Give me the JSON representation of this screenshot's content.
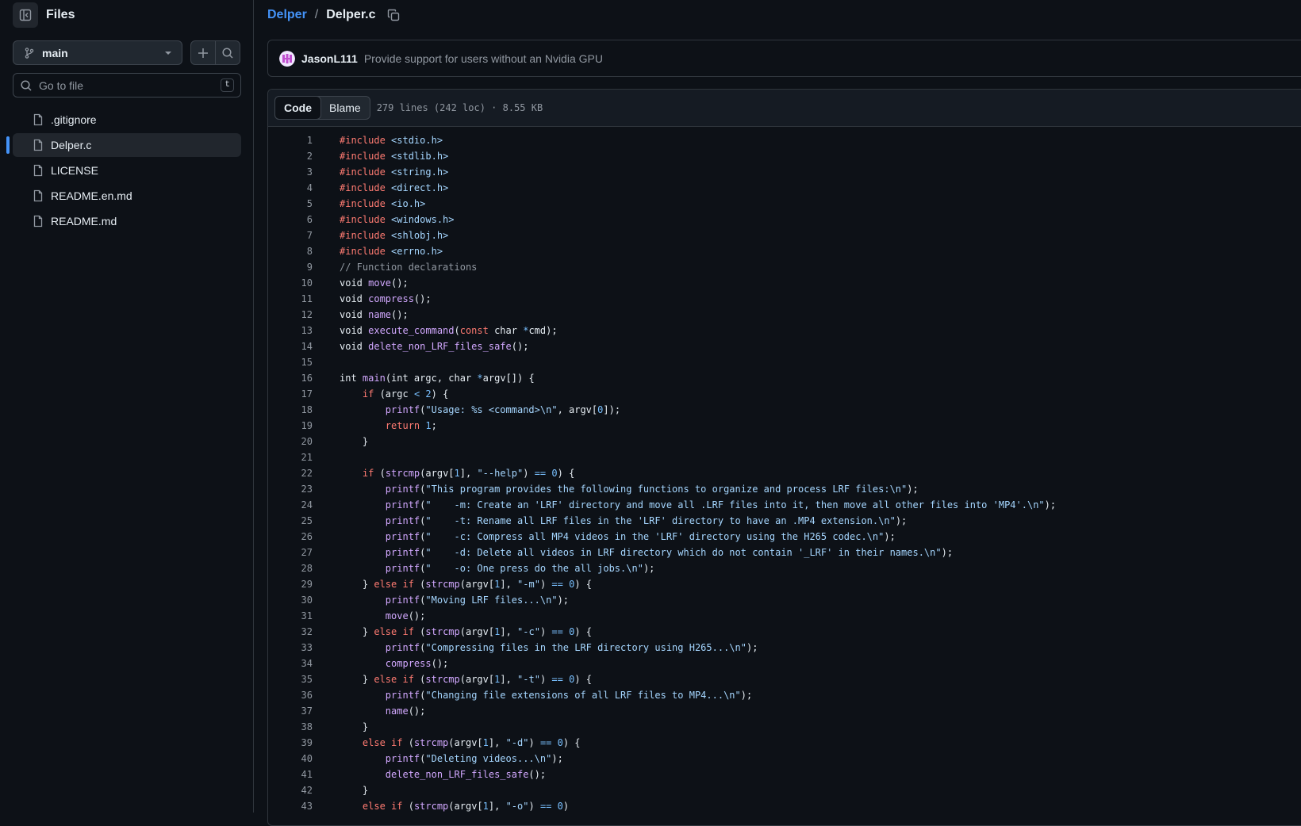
{
  "sidebar": {
    "title": "Files",
    "branch": "main",
    "goto_placeholder": "Go to file",
    "goto_shortcut": "t",
    "files": [
      ".gitignore",
      "Delper.c",
      "LICENSE",
      "README.en.md",
      "README.md"
    ]
  },
  "breadcrumb": {
    "repo": "Delper",
    "separator": "/",
    "file": "Delper.c"
  },
  "commit": {
    "author": "JasonL111",
    "message": "Provide support for users without an Nvidia GPU"
  },
  "viewer": {
    "tabs": [
      "Code",
      "Blame"
    ],
    "info": "279 lines (242 loc) · 8.55 KB",
    "lines": [
      [
        [
          "kw",
          "#include"
        ],
        [
          "t",
          " "
        ],
        [
          "str",
          "<stdio.h>"
        ]
      ],
      [
        [
          "kw",
          "#include"
        ],
        [
          "t",
          " "
        ],
        [
          "str",
          "<stdlib.h>"
        ]
      ],
      [
        [
          "kw",
          "#include"
        ],
        [
          "t",
          " "
        ],
        [
          "str",
          "<string.h>"
        ]
      ],
      [
        [
          "kw",
          "#include"
        ],
        [
          "t",
          " "
        ],
        [
          "str",
          "<direct.h>"
        ]
      ],
      [
        [
          "kw",
          "#include"
        ],
        [
          "t",
          " "
        ],
        [
          "str",
          "<io.h>"
        ]
      ],
      [
        [
          "kw",
          "#include"
        ],
        [
          "t",
          " "
        ],
        [
          "str",
          "<windows.h>"
        ]
      ],
      [
        [
          "kw",
          "#include"
        ],
        [
          "t",
          " "
        ],
        [
          "str",
          "<shlobj.h>"
        ]
      ],
      [
        [
          "kw",
          "#include"
        ],
        [
          "t",
          " "
        ],
        [
          "str",
          "<errno.h>"
        ]
      ],
      [
        [
          "cm",
          "// Function declarations"
        ]
      ],
      [
        [
          "t",
          "void "
        ],
        [
          "fn",
          "move"
        ],
        [
          "t",
          "();"
        ]
      ],
      [
        [
          "t",
          "void "
        ],
        [
          "fn",
          "compress"
        ],
        [
          "t",
          "();"
        ]
      ],
      [
        [
          "t",
          "void "
        ],
        [
          "fn",
          "name"
        ],
        [
          "t",
          "();"
        ]
      ],
      [
        [
          "t",
          "void "
        ],
        [
          "fn",
          "execute_command"
        ],
        [
          "t",
          "("
        ],
        [
          "kw",
          "const"
        ],
        [
          "t",
          " char "
        ],
        [
          "op",
          "*"
        ],
        [
          "t",
          "cmd);"
        ]
      ],
      [
        [
          "t",
          "void "
        ],
        [
          "fn",
          "delete_non_LRF_files_safe"
        ],
        [
          "t",
          "();"
        ]
      ],
      [],
      [
        [
          "t",
          "int "
        ],
        [
          "fn",
          "main"
        ],
        [
          "t",
          "(int argc, char "
        ],
        [
          "op",
          "*"
        ],
        [
          "t",
          "argv[]) {"
        ]
      ],
      [
        [
          "t",
          "    "
        ],
        [
          "kw",
          "if"
        ],
        [
          "t",
          " (argc "
        ],
        [
          "op",
          "<"
        ],
        [
          "t",
          " "
        ],
        [
          "num",
          "2"
        ],
        [
          "t",
          ") {"
        ]
      ],
      [
        [
          "t",
          "        "
        ],
        [
          "fn",
          "printf"
        ],
        [
          "t",
          "("
        ],
        [
          "str",
          "\"Usage: %s <command>\\n\""
        ],
        [
          "t",
          ", argv["
        ],
        [
          "num",
          "0"
        ],
        [
          "t",
          "]);"
        ]
      ],
      [
        [
          "t",
          "        "
        ],
        [
          "kw",
          "return"
        ],
        [
          "t",
          " "
        ],
        [
          "num",
          "1"
        ],
        [
          "t",
          ";"
        ]
      ],
      [
        [
          "t",
          "    }"
        ]
      ],
      [],
      [
        [
          "t",
          "    "
        ],
        [
          "kw",
          "if"
        ],
        [
          "t",
          " ("
        ],
        [
          "fn",
          "strcmp"
        ],
        [
          "t",
          "(argv["
        ],
        [
          "num",
          "1"
        ],
        [
          "t",
          "], "
        ],
        [
          "str",
          "\"--help\""
        ],
        [
          "t",
          ") "
        ],
        [
          "op",
          "=="
        ],
        [
          "t",
          " "
        ],
        [
          "num",
          "0"
        ],
        [
          "t",
          ") {"
        ]
      ],
      [
        [
          "t",
          "        "
        ],
        [
          "fn",
          "printf"
        ],
        [
          "t",
          "("
        ],
        [
          "str",
          "\"This program provides the following functions to organize and process LRF files:\\n\""
        ],
        [
          "t",
          ");"
        ]
      ],
      [
        [
          "t",
          "        "
        ],
        [
          "fn",
          "printf"
        ],
        [
          "t",
          "("
        ],
        [
          "str",
          "\"    -m: Create an 'LRF' directory and move all .LRF files into it, then move all other files into 'MP4'.\\n\""
        ],
        [
          "t",
          ");"
        ]
      ],
      [
        [
          "t",
          "        "
        ],
        [
          "fn",
          "printf"
        ],
        [
          "t",
          "("
        ],
        [
          "str",
          "\"    -t: Rename all LRF files in the 'LRF' directory to have an .MP4 extension.\\n\""
        ],
        [
          "t",
          ");"
        ]
      ],
      [
        [
          "t",
          "        "
        ],
        [
          "fn",
          "printf"
        ],
        [
          "t",
          "("
        ],
        [
          "str",
          "\"    -c: Compress all MP4 videos in the 'LRF' directory using the H265 codec.\\n\""
        ],
        [
          "t",
          ");"
        ]
      ],
      [
        [
          "t",
          "        "
        ],
        [
          "fn",
          "printf"
        ],
        [
          "t",
          "("
        ],
        [
          "str",
          "\"    -d: Delete all videos in LRF directory which do not contain '_LRF' in their names.\\n\""
        ],
        [
          "t",
          ");"
        ]
      ],
      [
        [
          "t",
          "        "
        ],
        [
          "fn",
          "printf"
        ],
        [
          "t",
          "("
        ],
        [
          "str",
          "\"    -o: One press do the all jobs.\\n\""
        ],
        [
          "t",
          ");"
        ]
      ],
      [
        [
          "t",
          "    } "
        ],
        [
          "kw",
          "else if"
        ],
        [
          "t",
          " ("
        ],
        [
          "fn",
          "strcmp"
        ],
        [
          "t",
          "(argv["
        ],
        [
          "num",
          "1"
        ],
        [
          "t",
          "], "
        ],
        [
          "str",
          "\"-m\""
        ],
        [
          "t",
          ") "
        ],
        [
          "op",
          "=="
        ],
        [
          "t",
          " "
        ],
        [
          "num",
          "0"
        ],
        [
          "t",
          ") {"
        ]
      ],
      [
        [
          "t",
          "        "
        ],
        [
          "fn",
          "printf"
        ],
        [
          "t",
          "("
        ],
        [
          "str",
          "\"Moving LRF files...\\n\""
        ],
        [
          "t",
          ");"
        ]
      ],
      [
        [
          "t",
          "        "
        ],
        [
          "fn",
          "move"
        ],
        [
          "t",
          "();"
        ]
      ],
      [
        [
          "t",
          "    } "
        ],
        [
          "kw",
          "else if"
        ],
        [
          "t",
          " ("
        ],
        [
          "fn",
          "strcmp"
        ],
        [
          "t",
          "(argv["
        ],
        [
          "num",
          "1"
        ],
        [
          "t",
          "], "
        ],
        [
          "str",
          "\"-c\""
        ],
        [
          "t",
          ") "
        ],
        [
          "op",
          "=="
        ],
        [
          "t",
          " "
        ],
        [
          "num",
          "0"
        ],
        [
          "t",
          ") {"
        ]
      ],
      [
        [
          "t",
          "        "
        ],
        [
          "fn",
          "printf"
        ],
        [
          "t",
          "("
        ],
        [
          "str",
          "\"Compressing files in the LRF directory using H265...\\n\""
        ],
        [
          "t",
          ");"
        ]
      ],
      [
        [
          "t",
          "        "
        ],
        [
          "fn",
          "compress"
        ],
        [
          "t",
          "();"
        ]
      ],
      [
        [
          "t",
          "    } "
        ],
        [
          "kw",
          "else if"
        ],
        [
          "t",
          " ("
        ],
        [
          "fn",
          "strcmp"
        ],
        [
          "t",
          "(argv["
        ],
        [
          "num",
          "1"
        ],
        [
          "t",
          "], "
        ],
        [
          "str",
          "\"-t\""
        ],
        [
          "t",
          ") "
        ],
        [
          "op",
          "=="
        ],
        [
          "t",
          " "
        ],
        [
          "num",
          "0"
        ],
        [
          "t",
          ") {"
        ]
      ],
      [
        [
          "t",
          "        "
        ],
        [
          "fn",
          "printf"
        ],
        [
          "t",
          "("
        ],
        [
          "str",
          "\"Changing file extensions of all LRF files to MP4...\\n\""
        ],
        [
          "t",
          ");"
        ]
      ],
      [
        [
          "t",
          "        "
        ],
        [
          "fn",
          "name"
        ],
        [
          "t",
          "();"
        ]
      ],
      [
        [
          "t",
          "    }"
        ]
      ],
      [
        [
          "t",
          "    "
        ],
        [
          "kw",
          "else if"
        ],
        [
          "t",
          " ("
        ],
        [
          "fn",
          "strcmp"
        ],
        [
          "t",
          "(argv["
        ],
        [
          "num",
          "1"
        ],
        [
          "t",
          "], "
        ],
        [
          "str",
          "\"-d\""
        ],
        [
          "t",
          ") "
        ],
        [
          "op",
          "=="
        ],
        [
          "t",
          " "
        ],
        [
          "num",
          "0"
        ],
        [
          "t",
          ") {"
        ]
      ],
      [
        [
          "t",
          "        "
        ],
        [
          "fn",
          "printf"
        ],
        [
          "t",
          "("
        ],
        [
          "str",
          "\"Deleting videos...\\n\""
        ],
        [
          "t",
          ");"
        ]
      ],
      [
        [
          "t",
          "        "
        ],
        [
          "fn",
          "delete_non_LRF_files_safe"
        ],
        [
          "t",
          "();"
        ]
      ],
      [
        [
          "t",
          "    }"
        ]
      ],
      [
        [
          "t",
          "    "
        ],
        [
          "kw",
          "else if"
        ],
        [
          "t",
          " ("
        ],
        [
          "fn",
          "strcmp"
        ],
        [
          "t",
          "(argv["
        ],
        [
          "num",
          "1"
        ],
        [
          "t",
          "], "
        ],
        [
          "str",
          "\"-o\""
        ],
        [
          "t",
          ") "
        ],
        [
          "op",
          "=="
        ],
        [
          "t",
          " "
        ],
        [
          "num",
          "0"
        ],
        [
          "t",
          ")"
        ]
      ]
    ]
  }
}
